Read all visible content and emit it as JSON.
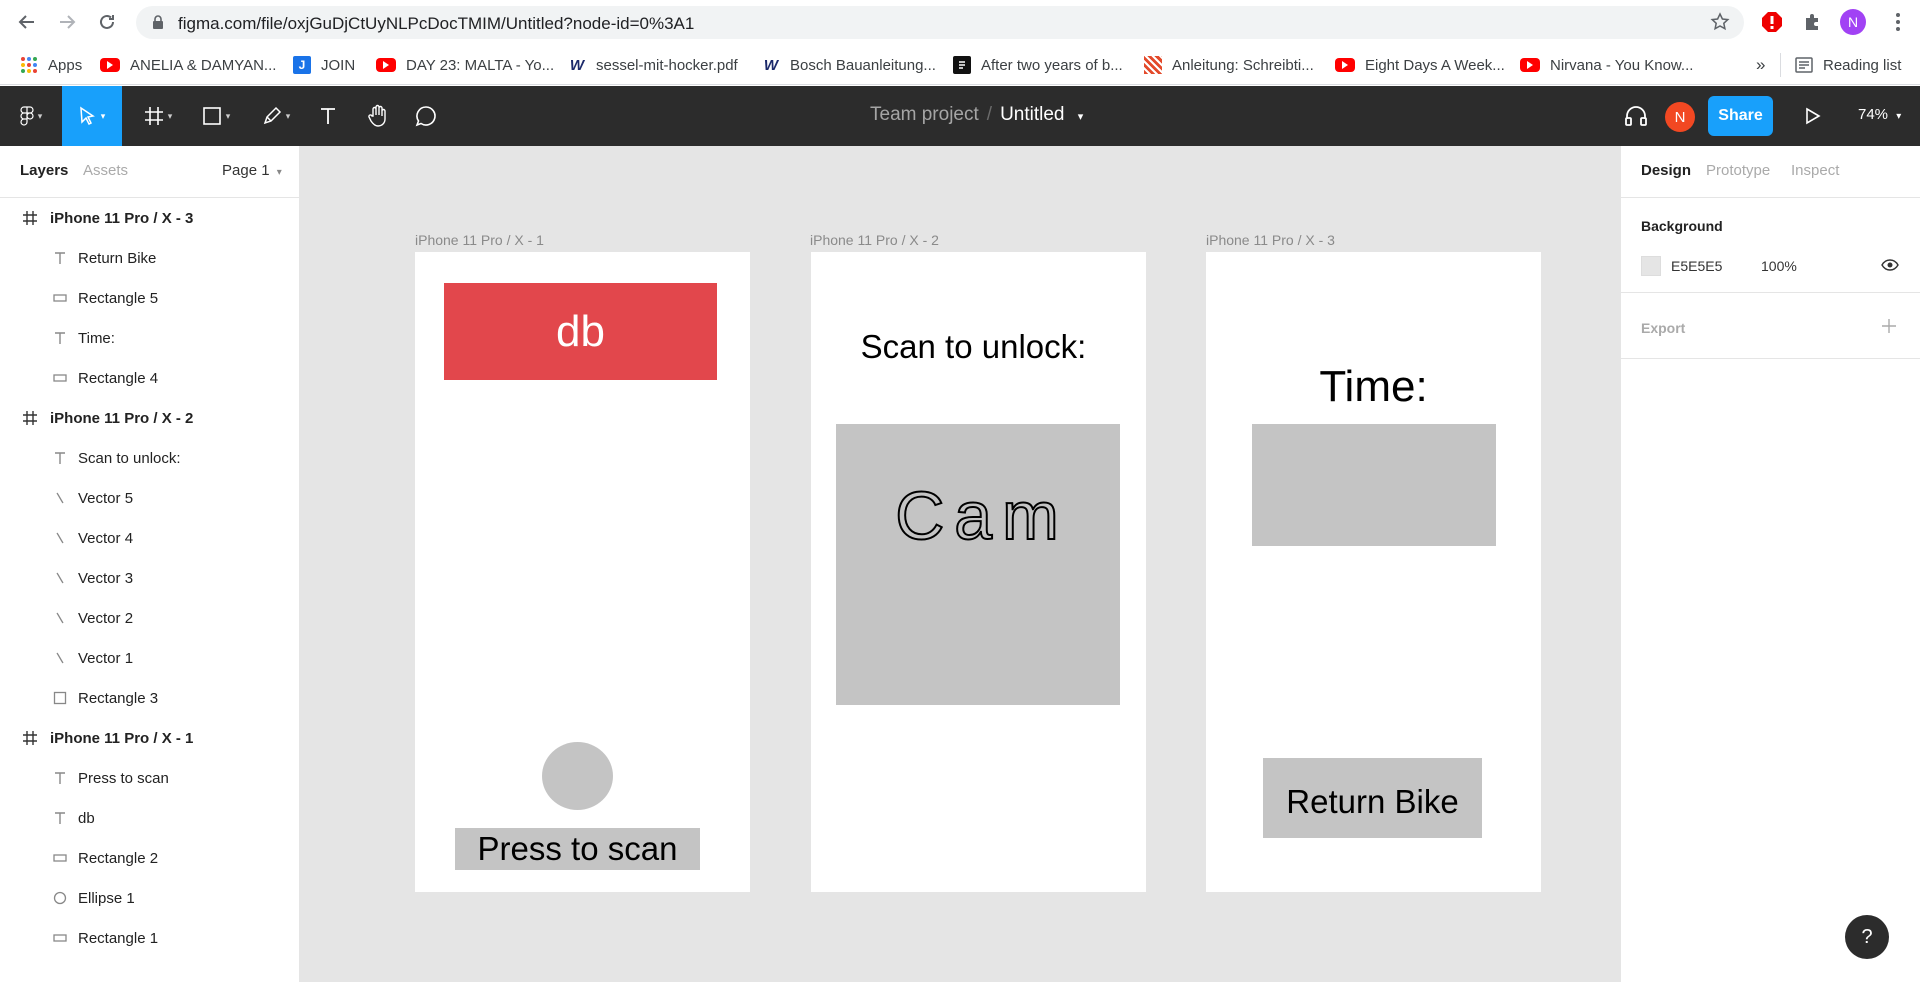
{
  "browser": {
    "url": "figma.com/file/oxjGuDjCtUyNLPcDocTMIM/Untitled?node-id=0%3A1",
    "profile_initial": "N",
    "bookmarks": [
      {
        "label": "Apps",
        "icon": "apps-grid-icon"
      },
      {
        "label": "ANELIA & DAMYAN...",
        "icon": "youtube-icon"
      },
      {
        "label": "JOIN",
        "icon": "join-icon"
      },
      {
        "label": "DAY 23: MALTA - Yo...",
        "icon": "youtube-icon"
      },
      {
        "label": "sessel-mit-hocker.pdf",
        "icon": "w-icon"
      },
      {
        "label": "Bosch Bauanleitung...",
        "icon": "w-icon"
      },
      {
        "label": "After two years of b...",
        "icon": "bookmark-icon"
      },
      {
        "label": "Anleitung: Schreibti...",
        "icon": "striped-icon"
      },
      {
        "label": "Eight Days A Week...",
        "icon": "youtube-icon"
      },
      {
        "label": "Nirvana - You Know...",
        "icon": "youtube-icon"
      }
    ],
    "more_bookmarks": "»",
    "reading_list": "Reading list"
  },
  "toolbar": {
    "team": "Team project",
    "separator": "/",
    "file_name": "Untitled",
    "avatar_initial": "N",
    "share_label": "Share",
    "zoom": "74%"
  },
  "left_panel": {
    "tabs": [
      "Layers",
      "Assets"
    ],
    "page": "Page 1",
    "layers": [
      {
        "label": "iPhone 11 Pro / X - 3",
        "type": "frame"
      },
      {
        "label": "Return Bike",
        "type": "text"
      },
      {
        "label": "Rectangle 5",
        "type": "rect"
      },
      {
        "label": "Time:",
        "type": "text"
      },
      {
        "label": "Rectangle 4",
        "type": "rect"
      },
      {
        "label": "iPhone 11 Pro / X - 2",
        "type": "frame"
      },
      {
        "label": "Scan to unlock:",
        "type": "text"
      },
      {
        "label": "Vector 5",
        "type": "vector"
      },
      {
        "label": "Vector 4",
        "type": "vector"
      },
      {
        "label": "Vector 3",
        "type": "vector"
      },
      {
        "label": "Vector 2",
        "type": "vector"
      },
      {
        "label": "Vector 1",
        "type": "vector"
      },
      {
        "label": "Rectangle 3",
        "type": "square"
      },
      {
        "label": "iPhone 11 Pro / X - 1",
        "type": "frame"
      },
      {
        "label": "Press to scan",
        "type": "text"
      },
      {
        "label": "db",
        "type": "text"
      },
      {
        "label": "Rectangle 2",
        "type": "rect"
      },
      {
        "label": "Ellipse 1",
        "type": "ellipse"
      },
      {
        "label": "Rectangle 1",
        "type": "rect"
      }
    ]
  },
  "canvas": {
    "frames": [
      {
        "label": "iPhone 11 Pro / X - 1"
      },
      {
        "label": "iPhone 11 Pro / X - 2"
      },
      {
        "label": "iPhone 11 Pro / X - 3"
      }
    ],
    "frame1": {
      "logo_text": "db",
      "logo_color": "#e2474c",
      "button_text": "Press to scan"
    },
    "frame2": {
      "heading": "Scan to unlock:",
      "cam_text": "Cam"
    },
    "frame3": {
      "heading": "Time:",
      "button_text": "Return Bike"
    }
  },
  "right_panel": {
    "tabs": [
      "Design",
      "Prototype",
      "Inspect"
    ],
    "background_label": "Background",
    "bg_hex": "E5E5E5",
    "bg_opacity": "100%",
    "export_label": "Export",
    "help": "?"
  },
  "colors": {
    "toolbar": "#2c2c2c",
    "accent": "#18a0fb",
    "canvas": "#e5e5e5",
    "shape_grey": "#c4c4c4"
  }
}
